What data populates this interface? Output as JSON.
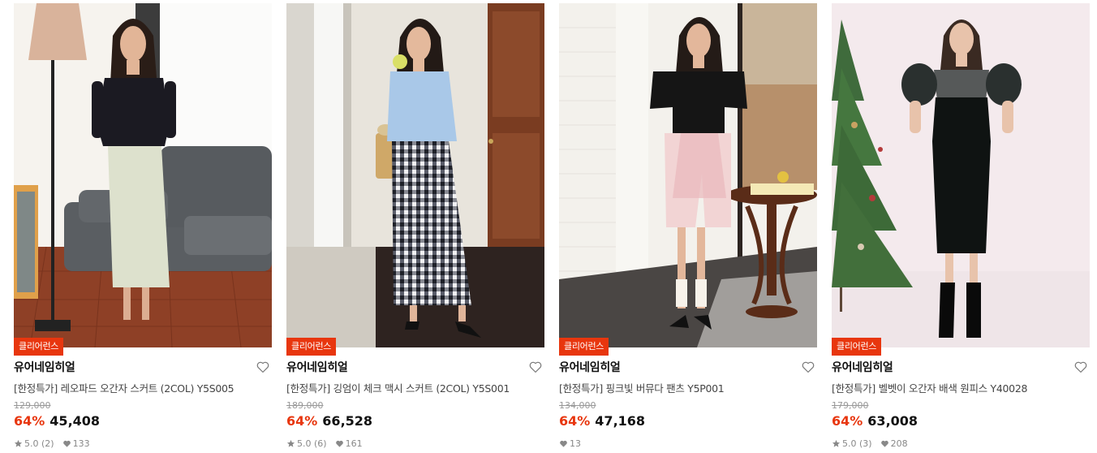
{
  "products": [
    {
      "badge": "클리어런스",
      "brand": "유어네임히얼",
      "title": "[한정특가] 레오파드 오간자 스커트 (2COL) Y5S005",
      "original_price": "129,000",
      "discount": "64%",
      "sale_price": "45,408",
      "rating": "5.0",
      "review_count": "(2)",
      "likes": "133",
      "photo": {
        "bg": "#f4f1ec",
        "wall": "#efeae2",
        "floor": "#8a3f26",
        "top_color": "#1b1a22",
        "bottom_color": "#dfe2cf",
        "prop": "sofa"
      }
    },
    {
      "badge": "클리어런스",
      "brand": "유어네임히얼",
      "title": "[한정특가] 깅엄이 체크 맥시 스커트 (2COL) Y5S001",
      "original_price": "189,000",
      "discount": "64%",
      "sale_price": "66,528",
      "rating": "5.0",
      "review_count": "(6)",
      "likes": "161",
      "photo": {
        "bg": "#ece8e2",
        "wall": "#e6e1d8",
        "floor": "#3a2a22",
        "top_color": "#a9c8e8",
        "bottom_color": "#2b2d3a",
        "prop": "door"
      }
    },
    {
      "badge": "클리어런스",
      "brand": "유어네임히얼",
      "title": "[한정특가] 핑크빛 버뮤다 팬츠 Y5P001",
      "original_price": "134,000",
      "discount": "64%",
      "sale_price": "47,168",
      "rating": "",
      "review_count": "",
      "likes": "13",
      "photo": {
        "bg": "#f0ece6",
        "wall": "#f6f4f0",
        "floor": "#4e4a48",
        "top_color": "#151515",
        "bottom_color": "#f0d3d3",
        "prop": "table"
      }
    },
    {
      "badge": "클리어런스",
      "brand": "유어네임히얼",
      "title": "[한정특가] 벨벳이 오간자 배색 원피스 Y40028",
      "original_price": "179,000",
      "discount": "64%",
      "sale_price": "63,008",
      "rating": "5.0",
      "review_count": "(3)",
      "likes": "208",
      "photo": {
        "bg": "#f3e9ec",
        "wall": "#f3e9ec",
        "floor": "#efe4e7",
        "top_color": "#0f1312",
        "bottom_color": "#0f1312",
        "prop": "tree"
      }
    }
  ],
  "colors": {
    "accent": "#e8360e",
    "muted": "#888888"
  },
  "icons": {
    "like": "heart-outline-icon",
    "star": "star-icon",
    "likes": "heart-filled-icon"
  }
}
